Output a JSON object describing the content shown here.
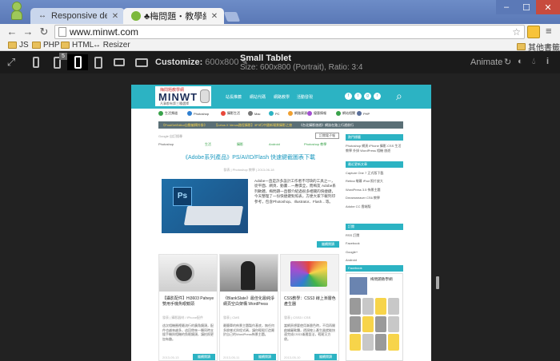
{
  "browser": {
    "tabs": [
      {
        "title": "Responsive design testi",
        "favicon": "↔"
      },
      {
        "title": "♣梅問題‧教學網【Minw",
        "favicon": ""
      }
    ],
    "url": "www.minwt.com"
  },
  "bookmarks": [
    {
      "label": "JS"
    },
    {
      "label": "PHP"
    },
    {
      "label": "HTML"
    },
    {
      "label": "↔ Resizer"
    },
    {
      "label": "其他書籤"
    }
  ],
  "resizer": {
    "customize_label": "Customize:",
    "customize_dims": "600x800",
    "device_badge": "5",
    "device_name": "Small Tablet",
    "device_size": "Size: 600x800 (Portrait), Ratio: 3:4",
    "animate_label": "Animate"
  },
  "site": {
    "logo": {
      "top": "梅問題教學網",
      "mark": "MINWT",
      "sub": "凡事都有第三種選擇"
    },
    "nav": [
      "站長推薦",
      "網站代碼",
      "網路教學",
      "活動發現"
    ],
    "social": [
      "f",
      "t",
      "g",
      "r"
    ],
    "categories": [
      "生活頻道",
      "Photoshop",
      "攝影生活",
      "Mac",
      "PC",
      "網路資源",
      "優惠情報",
      "網站相關",
      "PHP"
    ],
    "ticker": [
      "《PostGetEditor自動編輯外掛》",
      "【Letus X Venus路徑攝影】3P3行中國新場景攝影之旅",
      "《台北攝影旅遊》網誌在路上行遊前行"
    ],
    "breadcrumb": "Google 自訂搜尋",
    "bc_tabs": [
      "Photoshop",
      "生活",
      "攝影",
      "Android",
      "Photoshop 教學"
    ],
    "bc_right": "訂閱電子報",
    "post": {
      "title": "《Adobe系列產品》PS/AI/ID/Flash 快速鍵截圖表下載",
      "meta": "發表 | Photoshop 教學 | 2013-06-18",
      "text": "Adobe一直是許多設計工作者不可缺的工具之一，從平面、網頁、動畫…一應俱全，而梅友 Adobe系列軟體，梅問題一直都介紹過很多相關的快捷鍵，今天整理了一份快捷鍵對照表，方便大家下載列印參考，包含Photoshop、Illustrator、Flash…等。",
      "read_more": "繼續閱讀"
    },
    "cards": [
      {
        "title": "【攝影配件】Hi3603 Paheye 雙用手機魚眼鏡頭",
        "meta": "發表 | 攝影器材 / iPhone配件",
        "excerpt": "這次相機圈裡最流行的廣角鏡頭，配件也越來越多，這回帶來一顆同時支援手機與相機的魚眼鏡頭，讓拍照更加有趣。",
        "button": "繼續閱讀",
        "date": "2013-05-13"
      },
      {
        "title": "《BlankSlate》最佳化最純淨網頁空白架構 WordPress",
        "meta": "發表 | CMS",
        "excerpt": "最簡單的佈景主題製作基底，無任何多餘樣式與程式碼，讓你輕鬆打造屬於自己的WordPress佈景主題。",
        "button": "繼續閱讀",
        "date": "2013-05-11"
      },
      {
        "title": "CSS教學：CSS3 線上漸層色產生器",
        "meta": "發表 | CSS3 / CSS",
        "excerpt": "當網頁想要使用漸層色時，不用再開啟繪圖軟體，透過線上產生器就能快速完成CSS3漸層語法，輕鬆又方便。",
        "button": "繼續閱讀",
        "date": "2013-05-10"
      }
    ],
    "sidebar": {
      "headings": [
        "熱門標籤",
        "最近更新文章",
        "訂閱",
        "Facebook"
      ],
      "tags": "Photoshop 網頁 iPhone 攝影 CSS 生活 教學 外掛 WordPress 相機 旅遊",
      "recent": [
        "Capture One 7 正式版下載",
        "Retina 螢幕 iPad 照片放大",
        "WordPress 3.5 佈景主題",
        "Dreamweaver CS6 教學",
        "Adobe CC 雲端版"
      ],
      "subscribe": [
        "RSS 訂閱",
        "Facebook",
        "Google+",
        "Android"
      ],
      "fb_name": "梅問題教學網"
    }
  }
}
